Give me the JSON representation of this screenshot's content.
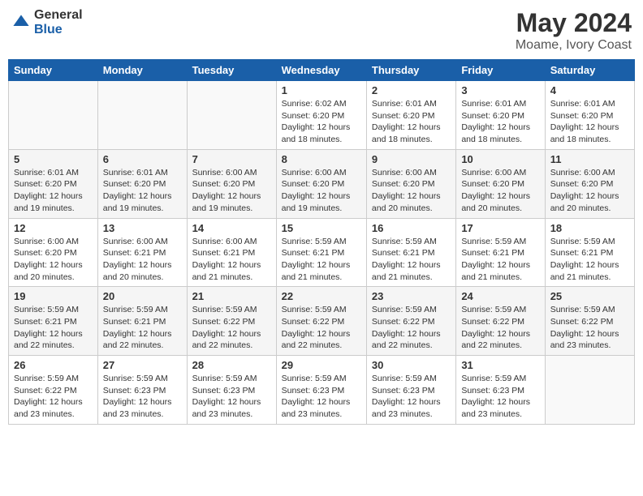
{
  "header": {
    "logo_general": "General",
    "logo_blue": "Blue",
    "month_title": "May 2024",
    "location": "Moame, Ivory Coast"
  },
  "days_of_week": [
    "Sunday",
    "Monday",
    "Tuesday",
    "Wednesday",
    "Thursday",
    "Friday",
    "Saturday"
  ],
  "weeks": [
    [
      {
        "day": "",
        "info": ""
      },
      {
        "day": "",
        "info": ""
      },
      {
        "day": "",
        "info": ""
      },
      {
        "day": "1",
        "info": "Sunrise: 6:02 AM\nSunset: 6:20 PM\nDaylight: 12 hours\nand 18 minutes."
      },
      {
        "day": "2",
        "info": "Sunrise: 6:01 AM\nSunset: 6:20 PM\nDaylight: 12 hours\nand 18 minutes."
      },
      {
        "day": "3",
        "info": "Sunrise: 6:01 AM\nSunset: 6:20 PM\nDaylight: 12 hours\nand 18 minutes."
      },
      {
        "day": "4",
        "info": "Sunrise: 6:01 AM\nSunset: 6:20 PM\nDaylight: 12 hours\nand 18 minutes."
      }
    ],
    [
      {
        "day": "5",
        "info": "Sunrise: 6:01 AM\nSunset: 6:20 PM\nDaylight: 12 hours\nand 19 minutes."
      },
      {
        "day": "6",
        "info": "Sunrise: 6:01 AM\nSunset: 6:20 PM\nDaylight: 12 hours\nand 19 minutes."
      },
      {
        "day": "7",
        "info": "Sunrise: 6:00 AM\nSunset: 6:20 PM\nDaylight: 12 hours\nand 19 minutes."
      },
      {
        "day": "8",
        "info": "Sunrise: 6:00 AM\nSunset: 6:20 PM\nDaylight: 12 hours\nand 19 minutes."
      },
      {
        "day": "9",
        "info": "Sunrise: 6:00 AM\nSunset: 6:20 PM\nDaylight: 12 hours\nand 20 minutes."
      },
      {
        "day": "10",
        "info": "Sunrise: 6:00 AM\nSunset: 6:20 PM\nDaylight: 12 hours\nand 20 minutes."
      },
      {
        "day": "11",
        "info": "Sunrise: 6:00 AM\nSunset: 6:20 PM\nDaylight: 12 hours\nand 20 minutes."
      }
    ],
    [
      {
        "day": "12",
        "info": "Sunrise: 6:00 AM\nSunset: 6:20 PM\nDaylight: 12 hours\nand 20 minutes."
      },
      {
        "day": "13",
        "info": "Sunrise: 6:00 AM\nSunset: 6:21 PM\nDaylight: 12 hours\nand 20 minutes."
      },
      {
        "day": "14",
        "info": "Sunrise: 6:00 AM\nSunset: 6:21 PM\nDaylight: 12 hours\nand 21 minutes."
      },
      {
        "day": "15",
        "info": "Sunrise: 5:59 AM\nSunset: 6:21 PM\nDaylight: 12 hours\nand 21 minutes."
      },
      {
        "day": "16",
        "info": "Sunrise: 5:59 AM\nSunset: 6:21 PM\nDaylight: 12 hours\nand 21 minutes."
      },
      {
        "day": "17",
        "info": "Sunrise: 5:59 AM\nSunset: 6:21 PM\nDaylight: 12 hours\nand 21 minutes."
      },
      {
        "day": "18",
        "info": "Sunrise: 5:59 AM\nSunset: 6:21 PM\nDaylight: 12 hours\nand 21 minutes."
      }
    ],
    [
      {
        "day": "19",
        "info": "Sunrise: 5:59 AM\nSunset: 6:21 PM\nDaylight: 12 hours\nand 22 minutes."
      },
      {
        "day": "20",
        "info": "Sunrise: 5:59 AM\nSunset: 6:21 PM\nDaylight: 12 hours\nand 22 minutes."
      },
      {
        "day": "21",
        "info": "Sunrise: 5:59 AM\nSunset: 6:22 PM\nDaylight: 12 hours\nand 22 minutes."
      },
      {
        "day": "22",
        "info": "Sunrise: 5:59 AM\nSunset: 6:22 PM\nDaylight: 12 hours\nand 22 minutes."
      },
      {
        "day": "23",
        "info": "Sunrise: 5:59 AM\nSunset: 6:22 PM\nDaylight: 12 hours\nand 22 minutes."
      },
      {
        "day": "24",
        "info": "Sunrise: 5:59 AM\nSunset: 6:22 PM\nDaylight: 12 hours\nand 22 minutes."
      },
      {
        "day": "25",
        "info": "Sunrise: 5:59 AM\nSunset: 6:22 PM\nDaylight: 12 hours\nand 23 minutes."
      }
    ],
    [
      {
        "day": "26",
        "info": "Sunrise: 5:59 AM\nSunset: 6:22 PM\nDaylight: 12 hours\nand 23 minutes."
      },
      {
        "day": "27",
        "info": "Sunrise: 5:59 AM\nSunset: 6:23 PM\nDaylight: 12 hours\nand 23 minutes."
      },
      {
        "day": "28",
        "info": "Sunrise: 5:59 AM\nSunset: 6:23 PM\nDaylight: 12 hours\nand 23 minutes."
      },
      {
        "day": "29",
        "info": "Sunrise: 5:59 AM\nSunset: 6:23 PM\nDaylight: 12 hours\nand 23 minutes."
      },
      {
        "day": "30",
        "info": "Sunrise: 5:59 AM\nSunset: 6:23 PM\nDaylight: 12 hours\nand 23 minutes."
      },
      {
        "day": "31",
        "info": "Sunrise: 5:59 AM\nSunset: 6:23 PM\nDaylight: 12 hours\nand 23 minutes."
      },
      {
        "day": "",
        "info": ""
      }
    ]
  ]
}
